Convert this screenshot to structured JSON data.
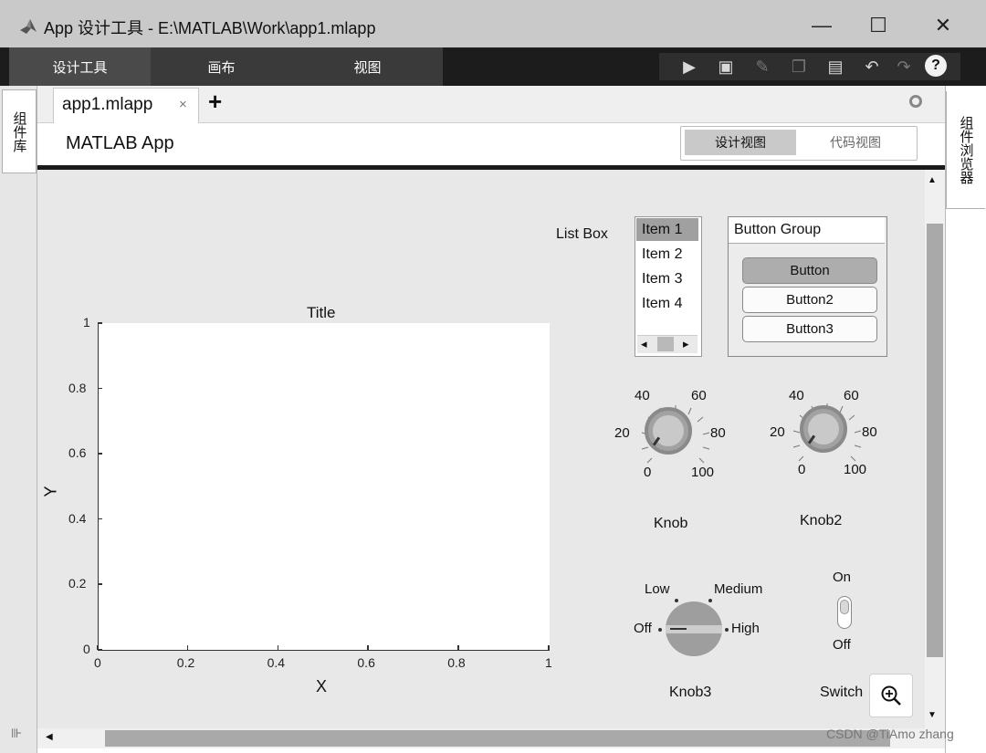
{
  "window": {
    "title": "App 设计工具 - E:\\MATLAB\\Work\\app1.mlapp",
    "minimize_glyph": "—",
    "maximize_glyph": "☐",
    "close_glyph": "✕"
  },
  "toolstrip": {
    "tabs": [
      "设计工具",
      "画布",
      "视图"
    ],
    "quick_access": [
      "run-icon",
      "save-icon",
      "brush-icon",
      "copy-icon",
      "paste-icon",
      "undo-icon",
      "redo-icon"
    ],
    "help_glyph": "?"
  },
  "left_panel": {
    "tab_label": "组件库",
    "expander_glyph": "⊪"
  },
  "right_panel": {
    "tab_label": "组件浏览器"
  },
  "document": {
    "tab_label": "app1.mlapp",
    "tab_close_glyph": "×",
    "add_tab_glyph": "+",
    "app_name": "MATLAB App",
    "view_buttons": [
      "设计视图",
      "代码视图"
    ],
    "active_view": "设计视图"
  },
  "axes": {
    "title": "Title",
    "xlabel": "X",
    "ylabel": "Y",
    "xticks": [
      "0",
      "0.2",
      "0.4",
      "0.6",
      "0.8",
      "1"
    ],
    "yticks": [
      "0",
      "0.2",
      "0.4",
      "0.6",
      "0.8",
      "1"
    ],
    "xlim": [
      0,
      1
    ],
    "ylim": [
      0,
      1
    ]
  },
  "list_box": {
    "label": "List Box",
    "items": [
      "Item 1",
      "Item 2",
      "Item 3",
      "Item 4"
    ],
    "selected": "Item 1",
    "scroll_left_glyph": "◂",
    "scroll_right_glyph": "▸"
  },
  "button_group": {
    "title": "Button Group",
    "buttons": [
      "Button",
      "Button2",
      "Button3"
    ],
    "selected": "Button"
  },
  "knob1": {
    "label": "Knob",
    "ticks": [
      "0",
      "20",
      "40",
      "60",
      "80",
      "100"
    ],
    "value": 0
  },
  "knob2": {
    "label": "Knob2",
    "ticks": [
      "0",
      "20",
      "40",
      "60",
      "80",
      "100"
    ],
    "value": 0
  },
  "knob3": {
    "label": "Knob3",
    "states": [
      "Off",
      "Low",
      "Medium",
      "High"
    ],
    "value": "Off"
  },
  "switch": {
    "label": "Switch",
    "on_label": "On",
    "off_label": "Off",
    "value": "Off"
  },
  "zoom": {
    "icon": "zoom-in-icon"
  },
  "watermark": "CSDN @TiAmo zhang",
  "colors": {
    "titlebar": "#c9c9c9",
    "toolstrip": "#1c1c1c",
    "canvas": "#e8e8e8",
    "selected": "#a0a0a0"
  }
}
